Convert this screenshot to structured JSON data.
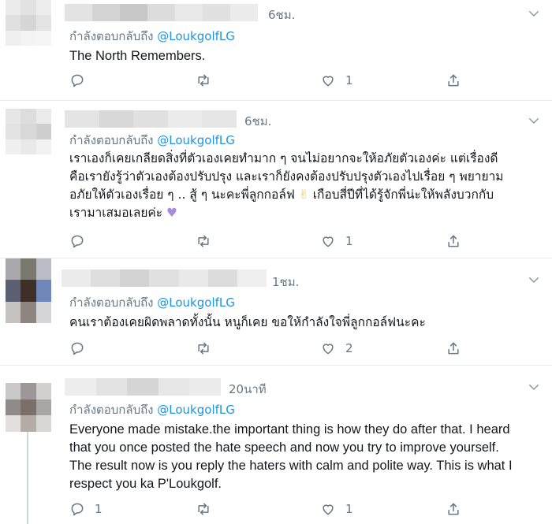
{
  "reply_prefix": "กำลังตอบกลับถึง",
  "tweets": [
    {
      "time": "6ชม.",
      "handle": "@LoukgolfLG",
      "text": "The North Remembers.",
      "lang": "en",
      "reply_count": "",
      "retweet_count": "",
      "like_count": "1"
    },
    {
      "time": "6ชม.",
      "handle": "@LoukgolfLG",
      "text_lines": [
        "เราเองก็เคยเกลียดสิ่งที่ตัวเองเคยทำมาก ๆ จนไม่อยากจะให้อภัยตัวเองค่ะ แต่เรื่องดี",
        "คือเรายังรู้ว่าตัวเองต้องปรับปรุง และเราก็ยังคงต้องปรับปรุงตัวเองไปเรื่อย ๆ พยายาม",
        "อภัยให้ตัวเองเรื่อย ๆ .. สู้ ๆ นะคะพี่ลูกกอล์ฟ",
        "เกือบสี่ปีที่ได้รู้จักพี่น่ะให้พลังบวกกับ",
        "เรามาเสมอเลยค่ะ"
      ],
      "emoji_1": "✌",
      "emoji_2": "♥",
      "reply_count": "",
      "retweet_count": "",
      "like_count": "1"
    },
    {
      "time": "1ชม.",
      "handle": "@LoukgolfLG",
      "text": "คนเราต้องเคยผิดพลาดทั้งนั้น หนูก็เคย ขอให้กำลังใจพี่ลูกกอล์ฟนะคะ",
      "reply_count": "",
      "retweet_count": "",
      "like_count": "2"
    },
    {
      "time": "20นาที",
      "handle": "@LoukgolfLG",
      "text_lines": [
        "Everyone made mistake.the important thing is how they do after that. I heard",
        "that you once posted the hate speech and now you try to improve yourself.",
        "The result now is you reply the haters with calm and polite way. This is what I",
        "respect you ka P'Loukgolf."
      ],
      "reply_count": "1",
      "retweet_count": "",
      "like_count": "1"
    }
  ],
  "colors": {
    "muted": "#657786",
    "link": "#1b95e0",
    "border": "#e6ecf0",
    "thread_line": "#ccd6dd"
  },
  "icons": [
    "reply-icon",
    "retweet-icon",
    "like-icon",
    "share-icon",
    "chevron-down-icon"
  ]
}
